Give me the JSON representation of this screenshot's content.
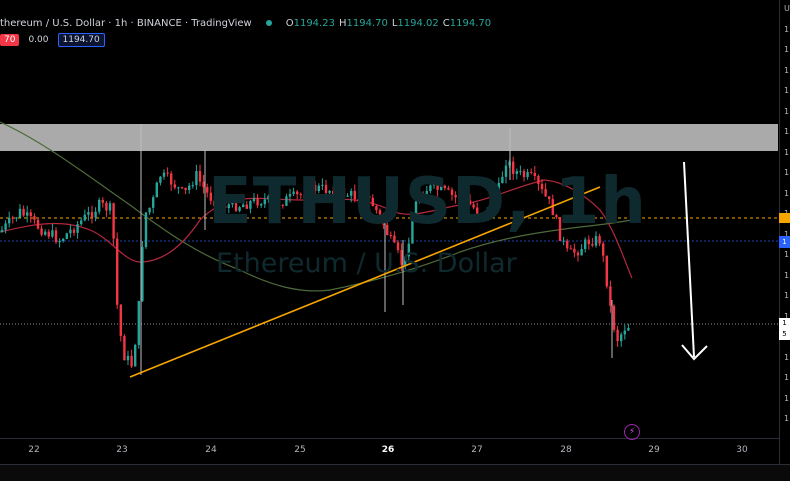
{
  "header": {
    "symbol_line": "thereum / U.S. Dollar · 1h · BINANCE · TradingView",
    "ohlc": [
      {
        "k": "O",
        "v": "1194.23"
      },
      {
        "k": "H",
        "v": "1194.70"
      },
      {
        "k": "L",
        "v": "1194.02"
      },
      {
        "k": "C",
        "v": "1194.70"
      }
    ],
    "sub": {
      "sell": "70",
      "spread": "0.00",
      "buy": "1194.70"
    }
  },
  "watermark": {
    "symbol": "ETHUSD, 1h",
    "name": "Ethereum / U.S. Dollar"
  },
  "time_axis": [
    {
      "label": "22",
      "bold": false
    },
    {
      "label": "23",
      "bold": false
    },
    {
      "label": "24",
      "bold": false
    },
    {
      "label": "25",
      "bold": false
    },
    {
      "label": "26",
      "bold": true
    },
    {
      "label": "27",
      "bold": false
    },
    {
      "label": "28",
      "bold": false
    },
    {
      "label": "29",
      "bold": false
    },
    {
      "label": "30",
      "bold": false
    }
  ],
  "price_scale": {
    "tick_labels": [
      "U",
      "1",
      "1",
      "1",
      "1",
      "1",
      "1",
      "1",
      "1",
      "1",
      "1",
      "1",
      "1",
      "1",
      "1",
      "1",
      "1",
      "1",
      "1",
      "1",
      "1"
    ],
    "box_labels": [
      "1",
      "1",
      "5"
    ]
  },
  "colors": {
    "up": "#26a69a",
    "down": "#f23645",
    "trendline": "#f7a600",
    "ma_fast": "#b3283c",
    "ma_slow": "#4f6b3a",
    "zone": "#c8c8c8"
  },
  "icons": [
    "lightning-icon",
    "down-arrow-icon"
  ]
}
